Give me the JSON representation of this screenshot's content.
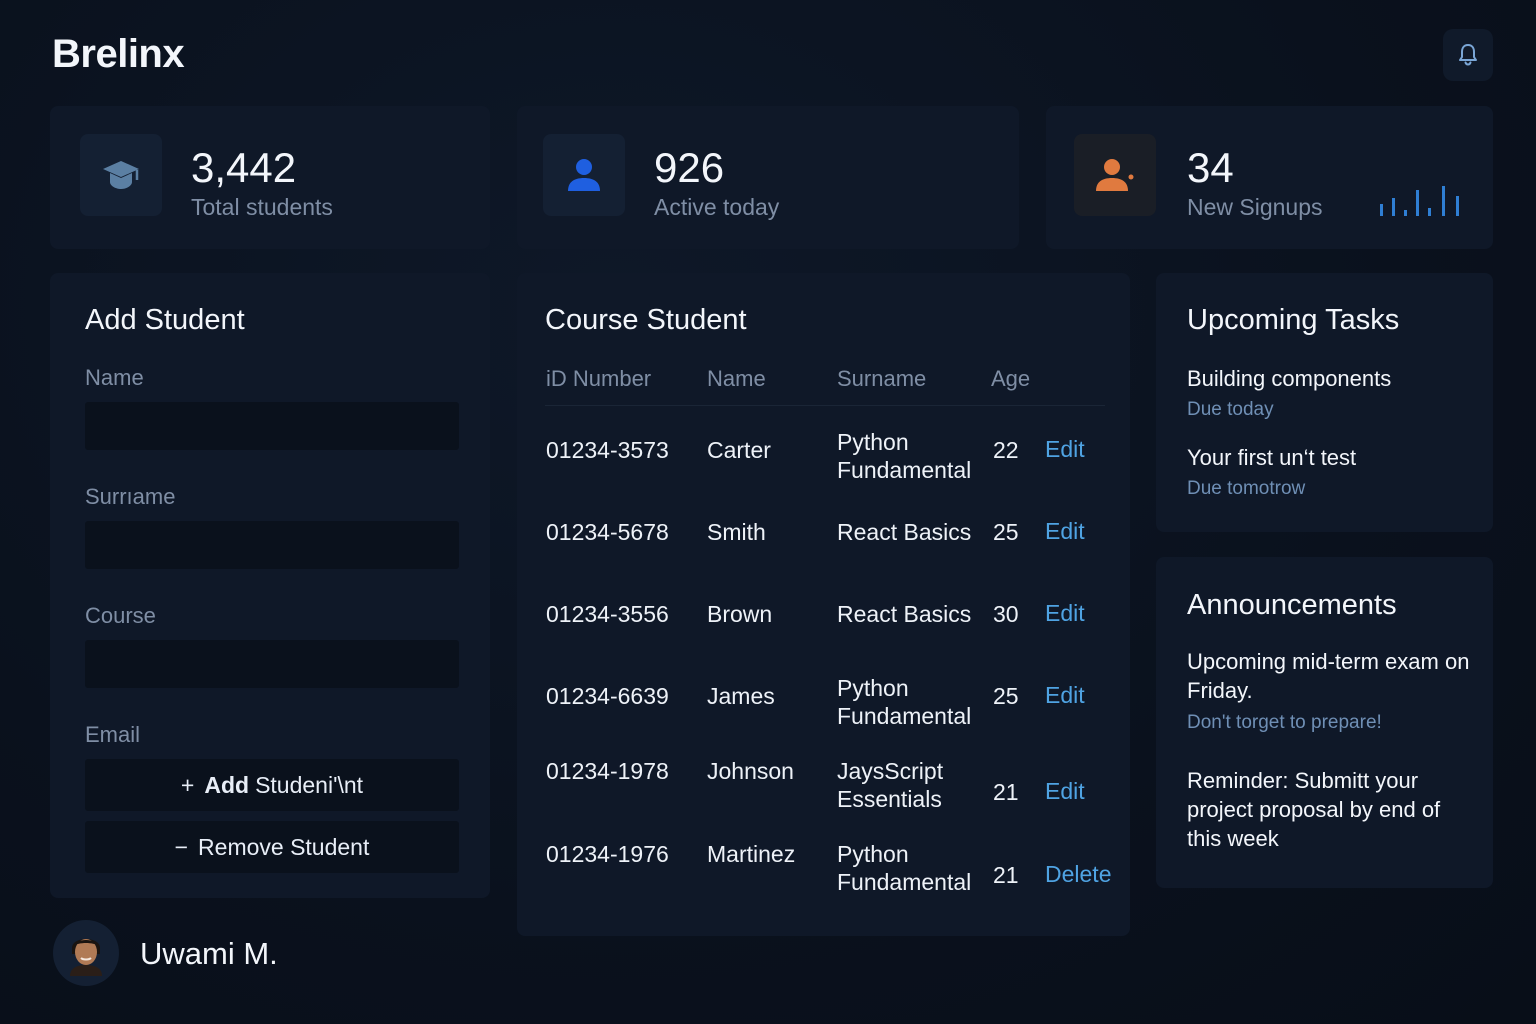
{
  "brand": "Brelinx",
  "header": {
    "bell_icon": "bell-icon"
  },
  "stats": [
    {
      "value": "3,442",
      "label": "Total students",
      "icon": "graduation-cap-icon",
      "color": "#5b7fa3"
    },
    {
      "value": "926",
      "label": "Active today",
      "icon": "user-icon",
      "color": "#1f5fe0"
    },
    {
      "value": "34",
      "label": "New Signups",
      "icon": "user-plus-icon",
      "color": "#e07a3f",
      "sparkline_color": "#2f7fd4"
    }
  ],
  "add_student": {
    "title": "Add Student",
    "fields": [
      {
        "label": "Name",
        "value": ""
      },
      {
        "label": "Surrıame",
        "value": ""
      },
      {
        "label": "Course",
        "value": ""
      },
      {
        "label": "Email"
      }
    ],
    "add_button": {
      "symbol": "+",
      "label_bold": "Add",
      "label_rest": "Studeni'\\nt"
    },
    "remove_button": {
      "symbol": "−",
      "label": "Remove Student"
    }
  },
  "course_student": {
    "title": "Course Student",
    "columns": [
      "iD Number",
      "Name",
      "Surname",
      "Age"
    ],
    "rows": [
      {
        "id": "01234-3573",
        "name": "Carter",
        "surname": "Python\nFundamental",
        "age": "22",
        "action": "Edit"
      },
      {
        "id": "01234-5678",
        "name": "Smith",
        "surname": "React Basics",
        "age": "25",
        "action": "Edit"
      },
      {
        "id": "01234-3556",
        "name": "Brown",
        "surname": "React Basics",
        "age": "30",
        "action": "Edit"
      },
      {
        "id": "01234-6639",
        "name": "James",
        "surname": "Python\nFundamental",
        "age": "25",
        "action": "Edit"
      },
      {
        "id": "01234-1978",
        "name": "Johnson",
        "surname": "JaysScript\nEssentials",
        "age": "21",
        "action": "Edit"
      },
      {
        "id": "01234-1976",
        "name": "Martinez",
        "surname": "Python\nFundamental",
        "age": "21",
        "action": "Delete"
      }
    ],
    "link_color": "#4fa3e3"
  },
  "tasks": {
    "title": "Upcoming Tasks",
    "items": [
      {
        "title": "Building components",
        "due": "Due today"
      },
      {
        "title": "Your first un‘t test",
        "due": "Due tomotrow"
      }
    ]
  },
  "announcements": {
    "title": "Announcements",
    "items": [
      {
        "text": "Upcoming mid-term exam on Friday.",
        "sub": "Don't torget to prepare!"
      },
      {
        "text": "Reminder: Submitt your project proposal by end of this week"
      }
    ]
  },
  "user": {
    "name": "Uwami M."
  }
}
